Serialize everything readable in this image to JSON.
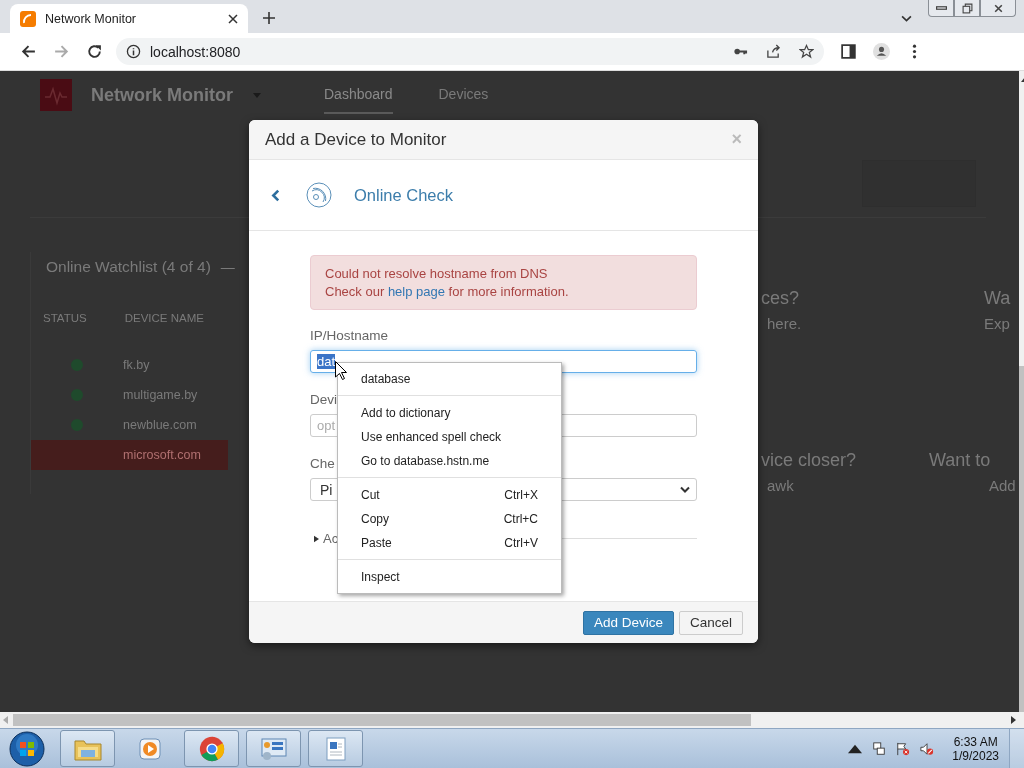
{
  "browser": {
    "tab": {
      "title": "Network Monitor",
      "selected": true
    },
    "address": "localhost:8080"
  },
  "page": {
    "app_title": "Network Monitor",
    "nav": [
      {
        "label": "Dashboard",
        "selected": true
      },
      {
        "label": "Devices",
        "selected": false
      }
    ],
    "watchlist": {
      "title": "Online Watchlist (4 of 4)",
      "collapse": "—",
      "columns": [
        "STATUS",
        "DEVICE NAME"
      ],
      "rows": [
        {
          "name": "fk.by",
          "dot": true,
          "selected": false
        },
        {
          "name": "multigame.by",
          "dot": true,
          "selected": false
        },
        {
          "name": "newblue.com",
          "dot": true,
          "selected": false
        },
        {
          "name": "microsoft.com",
          "dot": false,
          "selected": true
        }
      ]
    },
    "tips": [
      {
        "title": "ces?",
        "text": "here."
      },
      {
        "title": "Wa",
        "text": "Exp"
      },
      {
        "title": "vice closer?",
        "text": "awk"
      },
      {
        "title": "Want to",
        "text": "Add"
      }
    ]
  },
  "dialog": {
    "title": "Add a Device to Monitor",
    "close": "×",
    "step": "Online Check",
    "alert": {
      "line1": "Could not resolve hostname from DNS",
      "before": "Check our ",
      "link": "help page",
      "after": " for more information."
    },
    "fields": [
      {
        "kind": "text",
        "label": "IP/Hostname",
        "value": "dat",
        "focused": true,
        "text_selected": true
      },
      {
        "kind": "text",
        "label": "Devi",
        "placeholder": "opt",
        "focused": false
      },
      {
        "kind": "select",
        "label": "Che",
        "value": "Pi",
        "focused": false
      }
    ],
    "advanced": {
      "label": "Ac",
      "expanded": false
    },
    "buttons": [
      {
        "label": "Add Device",
        "kind": "primary"
      },
      {
        "label": "Cancel",
        "kind": "default"
      }
    ]
  },
  "context_menu": [
    {
      "kind": "suggestion",
      "label": "database"
    },
    {
      "kind": "separator"
    },
    {
      "kind": "item",
      "label": "Add to dictionary"
    },
    {
      "kind": "item",
      "label": "Use enhanced spell check"
    },
    {
      "kind": "item",
      "label": "Go to database.hstn.me"
    },
    {
      "kind": "separator"
    },
    {
      "kind": "item",
      "label": "Cut",
      "shortcut": "Ctrl+X"
    },
    {
      "kind": "item",
      "label": "Copy",
      "shortcut": "Ctrl+C"
    },
    {
      "kind": "item",
      "label": "Paste",
      "shortcut": "Ctrl+V"
    },
    {
      "kind": "separator"
    },
    {
      "kind": "item",
      "label": "Inspect"
    }
  ],
  "taskbar": {
    "apps": [
      {
        "kind": "explorer",
        "open": true
      },
      {
        "kind": "media",
        "open": false
      },
      {
        "kind": "chrome",
        "open": true
      },
      {
        "kind": "control",
        "open": true
      },
      {
        "kind": "wordpad",
        "open": true
      }
    ],
    "clock": {
      "time": "6:33 AM",
      "date": "1/9/2023"
    }
  }
}
